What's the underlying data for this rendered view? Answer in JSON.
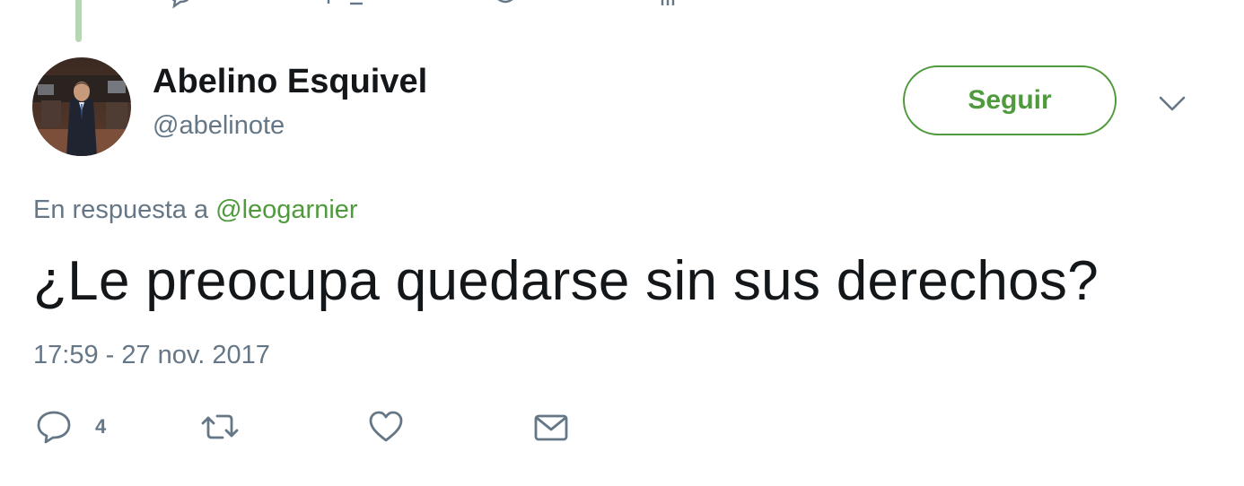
{
  "author": {
    "display_name": "Abelino Esquivel",
    "handle": "@abelinote"
  },
  "follow_button": {
    "label": "Seguir"
  },
  "reply_context": {
    "prefix": "En respuesta a",
    "mention": "@leogarnier"
  },
  "tweet": {
    "text": "¿Le preocupa quedarse sin sus derechos?",
    "timestamp": "17:59 - 27 nov. 2017"
  },
  "actions": {
    "reply_count": "4"
  },
  "icons": {
    "reply": "reply-icon",
    "retweet": "retweet-icon",
    "like": "heart-icon",
    "dm": "envelope-icon",
    "more": "chevron-down-icon"
  },
  "colors": {
    "accent": "#4f9a3c",
    "thread_line": "#b7d7b4",
    "text_primary": "#14171a",
    "text_secondary": "#657786"
  }
}
